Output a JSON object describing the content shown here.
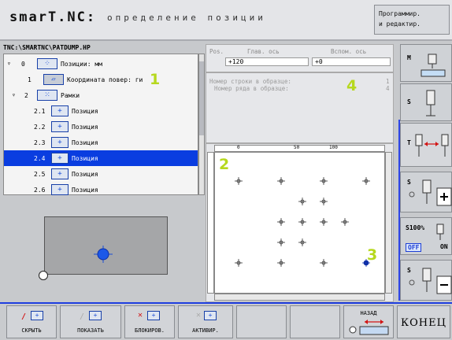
{
  "header": {
    "app_title": "smarT.NC:",
    "app_subtitle": "определение позиции",
    "mode_line1": "Программир.",
    "mode_line2": "и редактир."
  },
  "tree": {
    "path": "TNC:\\SMARTNC\\PATDUMP.HP",
    "rows": [
      {
        "num": "0",
        "arrow": "▿",
        "label": "Позиции: мм"
      },
      {
        "num": "1",
        "arrow": "",
        "label": "Координата повер: ги"
      },
      {
        "num": "2",
        "arrow": "▿",
        "label": "Рамки"
      },
      {
        "num": "2.1",
        "arrow": "",
        "label": "Позиция"
      },
      {
        "num": "2.2",
        "arrow": "",
        "label": "Позиция"
      },
      {
        "num": "2.3",
        "arrow": "",
        "label": "Позиция"
      },
      {
        "num": "2.4",
        "arrow": "",
        "label": "Позиция"
      },
      {
        "num": "2.5",
        "arrow": "",
        "label": "Позиция"
      },
      {
        "num": "2.6",
        "arrow": "",
        "label": "Позиция"
      }
    ]
  },
  "pos_panel": {
    "pos_label": "Pos.",
    "main_axis_label": "Глав. ось",
    "aux_axis_label": "Вспом. ось",
    "main_axis_value": "+120",
    "aux_axis_value": "+0"
  },
  "info_panel": {
    "row_label": "Номер строки в образце:",
    "row_value": "1",
    "col_label": "Номер ряда в образце:",
    "col_value": "4"
  },
  "graph": {
    "ruler_ticks": [
      "0",
      "50",
      "100"
    ],
    "points": [
      [
        0,
        0
      ],
      [
        1,
        0
      ],
      [
        2,
        0
      ],
      [
        3,
        0
      ],
      [
        1.5,
        1
      ],
      [
        2,
        1
      ],
      [
        1,
        2
      ],
      [
        1.5,
        2
      ],
      [
        2,
        2
      ],
      [
        2.5,
        2
      ],
      [
        1,
        3
      ],
      [
        1.5,
        3
      ],
      [
        0,
        4
      ],
      [
        1,
        4
      ],
      [
        2,
        4
      ],
      [
        3,
        4
      ]
    ]
  },
  "callouts": {
    "c1": "1",
    "c2": "2",
    "c3": "3",
    "c4": "4"
  },
  "right_softkeys": {
    "m_label": "M",
    "s_label": "S",
    "t_label": "T",
    "s2_label": "S",
    "spindle_pct": "S100%",
    "off_label": "OFF",
    "on_label": "ON",
    "s3_label": "S"
  },
  "bottom_softkeys": {
    "hide": "СКРЫТЬ",
    "show": "ПОКАЗАТЬ",
    "block": "БЛОКИРОВ.",
    "activate": "АКТИВИР.",
    "back": "НАЗАД",
    "end": "КОНЕЦ"
  }
}
